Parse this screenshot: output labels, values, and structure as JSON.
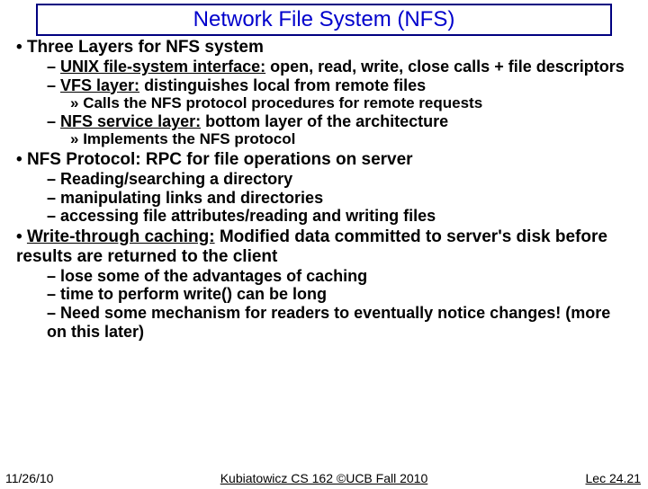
{
  "title": "Network File System (NFS)",
  "b1_1": "Three Layers for NFS system",
  "b2_1a_label": "UNIX file-system interface:",
  "b2_1a_rest": " open, read, write, close calls + file descriptors",
  "b2_1b_label": "VFS layer:",
  "b2_1b_rest": " distinguishes local from remote files",
  "b3_1b_1": "Calls the NFS protocol procedures for remote requests",
  "b2_1c_label": "NFS service layer:",
  "b2_1c_rest": " bottom layer of the architecture",
  "b3_1c_1": "Implements the NFS protocol",
  "b1_2": "NFS Protocol: RPC for file operations on server",
  "b2_2a": "Reading/searching a directory",
  "b2_2b": "manipulating links and directories",
  "b2_2c": "accessing file attributes/reading and writing files",
  "b1_3_label": "Write-through caching:",
  "b1_3_rest": " Modified data committed to server's disk before results are returned to the client",
  "b2_3a": "lose some of the advantages of caching",
  "b2_3b": "time to perform write() can be long",
  "b2_3c": "Need some mechanism for readers to eventually notice changes! (more on this later)",
  "footer": {
    "left": "11/26/10",
    "center": "Kubiatowicz CS 162 ©UCB Fall 2010",
    "right": "Lec 24.21"
  }
}
